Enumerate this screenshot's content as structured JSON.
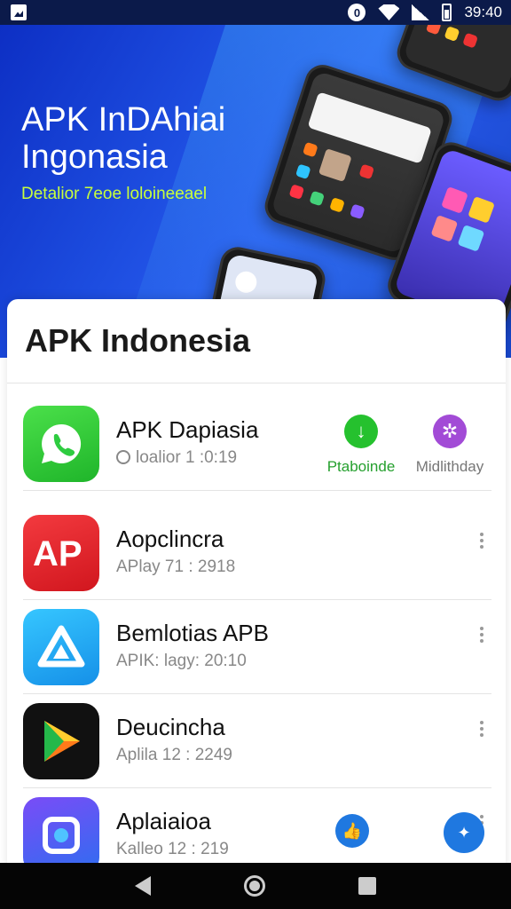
{
  "status_bar": {
    "time": "39:40",
    "circle_glyph": "0"
  },
  "hero": {
    "title_line1": "APK InDAhiai",
    "title_line2": "Ingonasia",
    "subtitle": "Detalior 7eoe loloineeael"
  },
  "page": {
    "title": "APK Indonesia"
  },
  "apps": [
    {
      "name": "APK Dapiasia",
      "meta": "loalior 1 :0:19",
      "icon": "phone-icon",
      "color": "#2ecc40",
      "actions": [
        {
          "label": "Ptaboinde",
          "icon": "download-arrow-icon",
          "color": "#25c12e"
        },
        {
          "label": "Midlithday",
          "icon": "share-gear-icon",
          "color": "#a24bd6"
        }
      ]
    },
    {
      "name": "Aopclincra",
      "meta": "APlay 71 : 2918",
      "icon": "ap-logo-icon",
      "color": "#e3262d"
    },
    {
      "name": "Bemlotias APB",
      "meta": "APIK: lagy: 20:10",
      "icon": "triangle-logo-icon",
      "color": "#20a8ef"
    },
    {
      "name": "Deucincha",
      "meta": "Aplila 12 : 2249",
      "icon": "play-triangle-icon",
      "color": "#111111"
    },
    {
      "name": "Aplaiaioa",
      "meta": "Kalleo 12 : 219",
      "icon": "camera-square-icon",
      "color": "#5a5cf0"
    }
  ],
  "bottom_actions": [
    {
      "icon": "thumbs-up-icon",
      "color": "#1f78e0"
    },
    {
      "icon": "rocket-icon",
      "color": "#1f78e0"
    }
  ]
}
